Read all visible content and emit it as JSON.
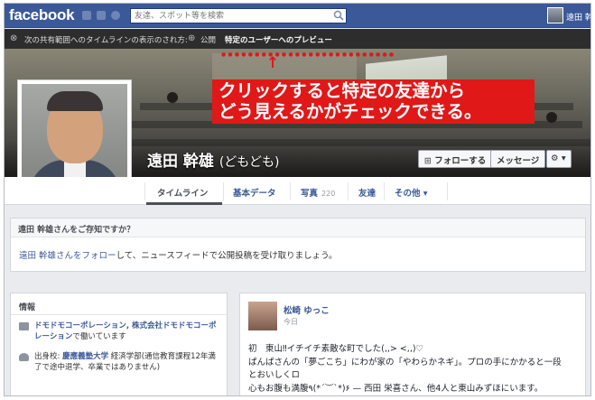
{
  "topbar": {
    "logo": "facebook",
    "search_placeholder": "友達、スポット等を検索",
    "user_name": "遠田 幹雄"
  },
  "preview_bar": {
    "text": "次の共有範囲へのタイムラインの表示のされ方:",
    "public_option": "公開",
    "active_option": "特定のユーザーへのプレビュー"
  },
  "annotation": {
    "line1": "クリックすると特定の友達から",
    "line2": "どう見えるかがチェックできる。"
  },
  "profile": {
    "name": "遠田 幹雄",
    "nickname": "(どもども)",
    "follow_button": "フォローする",
    "message_button": "メッセージ",
    "gear_button": "⚙ ▾"
  },
  "tabs": [
    {
      "label": "タイムライン"
    },
    {
      "label": "基本データ"
    },
    {
      "label": "写真",
      "count": "220"
    },
    {
      "label": "友達"
    },
    {
      "label": "その他 ▾"
    }
  ],
  "know_box": {
    "heading": "遠田 幹雄さんをご存知ですか？",
    "link": "遠田 幹雄さんをフォロー",
    "text": "して、ニュースフィードで公開投稿を受け取りましょう。"
  },
  "info": {
    "heading": "情報",
    "work": "ドモドモコーポレーション, 株式会社ドモドモコーポレーション",
    "work_suffix": "で働いています",
    "edu_prefix": "出身校:",
    "edu_school": "慶應義塾大学",
    "edu_detail": "経済学部(通信教育課程12年満了で途中退学、卒業ではありません)"
  },
  "post": {
    "author": "松崎 ゆっこ",
    "time": "今日",
    "lines": [
      "初　東山‼イチイチ素敵な町でした(,,> <,,)♡",
      "ぱんぱさんの「夢ごこち」にわが家の「やわらかネギ」。プロの手にかかると一段",
      "とおいしくロ",
      "心もお腹も満腹٩(*´︶`*)۶ — 西田 栄喜さん、他4人と東山みずほにいます。"
    ]
  }
}
